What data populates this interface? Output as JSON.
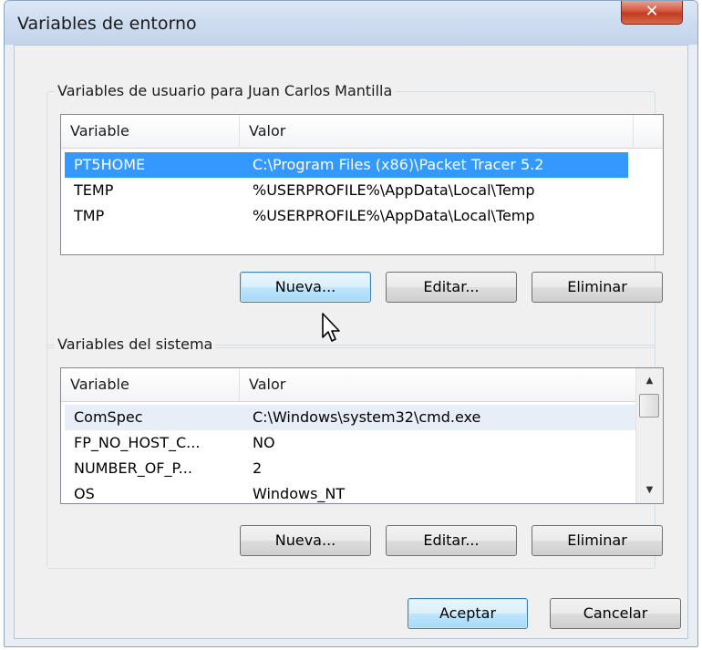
{
  "window": {
    "title": "Variables de entorno",
    "close_glyph": "✕"
  },
  "user_group": {
    "label": "Variables de usuario para Juan Carlos Mantilla",
    "columns": [
      "Variable",
      "Valor"
    ],
    "rows": [
      {
        "variable": "PT5HOME",
        "value": "C:\\Program Files (x86)\\Packet Tracer 5.2"
      },
      {
        "variable": "TEMP",
        "value": "%USERPROFILE%\\AppData\\Local\\Temp"
      },
      {
        "variable": "TMP",
        "value": "%USERPROFILE%\\AppData\\Local\\Temp"
      }
    ],
    "buttons": {
      "new": "Nueva...",
      "edit": "Editar...",
      "delete": "Eliminar"
    }
  },
  "system_group": {
    "label": "Variables del sistema",
    "columns": [
      "Variable",
      "Valor"
    ],
    "rows": [
      {
        "variable": "ComSpec",
        "value": "C:\\Windows\\system32\\cmd.exe"
      },
      {
        "variable": "FP_NO_HOST_C...",
        "value": "NO"
      },
      {
        "variable": "NUMBER_OF_P...",
        "value": "2"
      },
      {
        "variable": "OS",
        "value": "Windows_NT"
      }
    ],
    "buttons": {
      "new": "Nueva...",
      "edit": "Editar...",
      "delete": "Eliminar"
    }
  },
  "footer": {
    "ok": "Aceptar",
    "cancel": "Cancelar"
  },
  "colors": {
    "selection": "#3399ff",
    "titlebar": "#c2d4ec",
    "close": "#c23b20"
  },
  "icons": [
    "close-icon",
    "scroll-up-icon",
    "scroll-down-icon",
    "mouse-pointer-icon"
  ]
}
